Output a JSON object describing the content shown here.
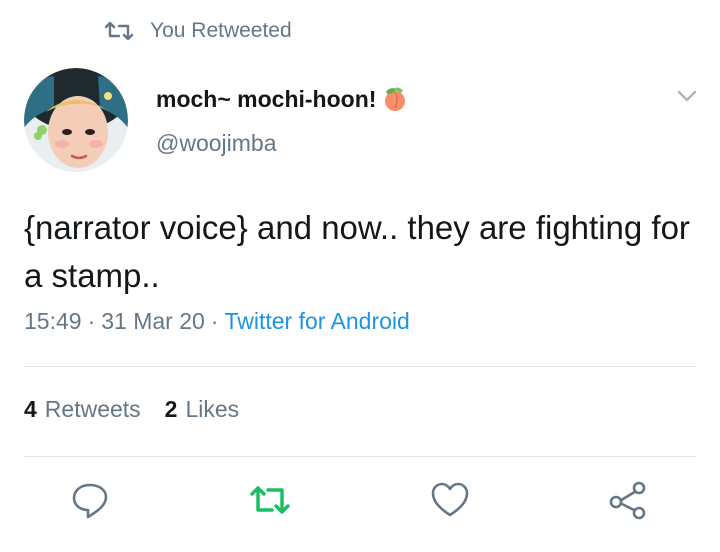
{
  "retweet_context": {
    "label": "You Retweeted",
    "icon": "retweet-icon"
  },
  "author": {
    "display_name": "moch~ mochi-hoon!",
    "emoji": "peach-emoji",
    "handle": "@woojimba"
  },
  "tweet": {
    "text": "{narrator voice} and now.. they are fighting for a stamp.."
  },
  "meta": {
    "time": "15:49",
    "date": "31 Mar 20",
    "client": "Twitter for Android",
    "separator": "·"
  },
  "stats": {
    "retweets_count": "4",
    "retweets_label": "Retweets",
    "likes_count": "2",
    "likes_label": "Likes"
  },
  "actions": [
    {
      "name": "reply",
      "icon": "reply-icon"
    },
    {
      "name": "retweet",
      "icon": "retweet-icon",
      "active_color": "#17bf63"
    },
    {
      "name": "like",
      "icon": "heart-icon"
    },
    {
      "name": "share",
      "icon": "share-icon"
    }
  ],
  "colors": {
    "primary_text": "#14171a",
    "secondary_text": "#657786",
    "link": "#1b95e0",
    "retweet_green": "#17bf63",
    "divider": "#e1e8ed"
  }
}
